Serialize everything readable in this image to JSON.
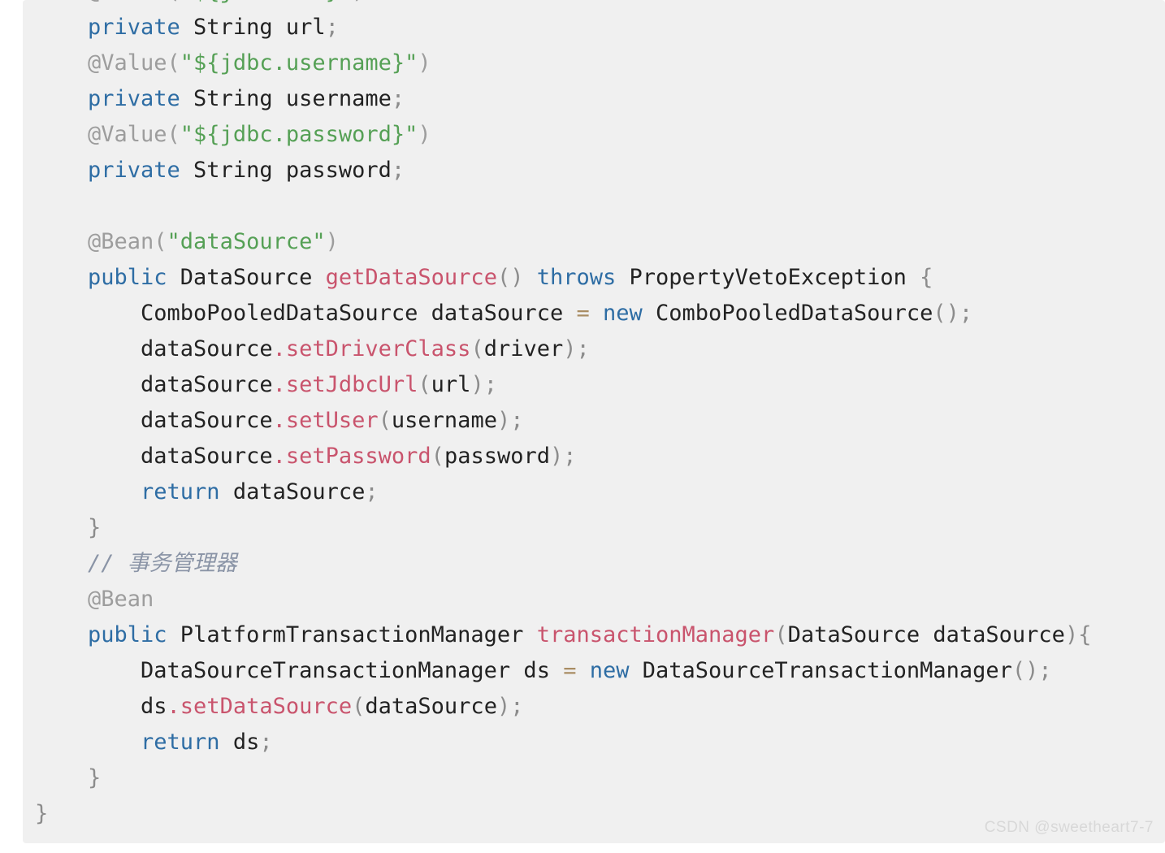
{
  "code_block": {
    "language": "java",
    "background_color": "#f0f0f0",
    "watermark": "CSDN @sweetheart7-7",
    "colors": {
      "keyword": "#2e6da4",
      "identifier": "#222222",
      "annotation": "#9d9d9d",
      "string": "#55a055",
      "method": "#c9546d",
      "punctuation": "#8c8c8c",
      "operator": "#a98d63",
      "comment": "#8a94a6"
    },
    "lines": [
      {
        "indent": 0,
        "tokens": [
          {
            "t": "ann",
            "v": "@Value("
          },
          {
            "t": "str",
            "v": "\"${jdbc.url}\""
          },
          {
            "t": "ann",
            "v": ")"
          }
        ]
      },
      {
        "indent": 0,
        "tokens": [
          {
            "t": "kw",
            "v": "private"
          },
          {
            "t": "plain",
            "v": " String url"
          },
          {
            "t": "punc",
            "v": ";"
          }
        ]
      },
      {
        "indent": 0,
        "tokens": [
          {
            "t": "ann",
            "v": "@Value("
          },
          {
            "t": "str",
            "v": "\"${jdbc.username}\""
          },
          {
            "t": "ann",
            "v": ")"
          }
        ]
      },
      {
        "indent": 0,
        "tokens": [
          {
            "t": "kw",
            "v": "private"
          },
          {
            "t": "plain",
            "v": " String username"
          },
          {
            "t": "punc",
            "v": ";"
          }
        ]
      },
      {
        "indent": 0,
        "tokens": [
          {
            "t": "ann",
            "v": "@Value("
          },
          {
            "t": "str",
            "v": "\"${jdbc.password}\""
          },
          {
            "t": "ann",
            "v": ")"
          }
        ]
      },
      {
        "indent": 0,
        "tokens": [
          {
            "t": "kw",
            "v": "private"
          },
          {
            "t": "plain",
            "v": " String password"
          },
          {
            "t": "punc",
            "v": ";"
          }
        ]
      },
      {
        "indent": 0,
        "tokens": []
      },
      {
        "indent": 0,
        "tokens": [
          {
            "t": "ann",
            "v": "@Bean("
          },
          {
            "t": "str",
            "v": "\"dataSource\""
          },
          {
            "t": "ann",
            "v": ")"
          }
        ]
      },
      {
        "indent": 0,
        "tokens": [
          {
            "t": "kw",
            "v": "public"
          },
          {
            "t": "plain",
            "v": " DataSource "
          },
          {
            "t": "meth",
            "v": "getDataSource"
          },
          {
            "t": "punc",
            "v": "()"
          },
          {
            "t": "plain",
            "v": " "
          },
          {
            "t": "kw",
            "v": "throws"
          },
          {
            "t": "plain",
            "v": " PropertyVetoException "
          },
          {
            "t": "punc",
            "v": "{"
          }
        ]
      },
      {
        "indent": 1,
        "tokens": [
          {
            "t": "plain",
            "v": "ComboPooledDataSource dataSource "
          },
          {
            "t": "op",
            "v": "="
          },
          {
            "t": "plain",
            "v": " "
          },
          {
            "t": "kw",
            "v": "new"
          },
          {
            "t": "plain",
            "v": " ComboPooledDataSource"
          },
          {
            "t": "punc",
            "v": "();"
          }
        ]
      },
      {
        "indent": 1,
        "tokens": [
          {
            "t": "plain",
            "v": "dataSource"
          },
          {
            "t": "meth",
            "v": ".setDriverClass"
          },
          {
            "t": "punc",
            "v": "("
          },
          {
            "t": "plain",
            "v": "driver"
          },
          {
            "t": "punc",
            "v": ");"
          }
        ]
      },
      {
        "indent": 1,
        "tokens": [
          {
            "t": "plain",
            "v": "dataSource"
          },
          {
            "t": "meth",
            "v": ".setJdbcUrl"
          },
          {
            "t": "punc",
            "v": "("
          },
          {
            "t": "plain",
            "v": "url"
          },
          {
            "t": "punc",
            "v": ");"
          }
        ]
      },
      {
        "indent": 1,
        "tokens": [
          {
            "t": "plain",
            "v": "dataSource"
          },
          {
            "t": "meth",
            "v": ".setUser"
          },
          {
            "t": "punc",
            "v": "("
          },
          {
            "t": "plain",
            "v": "username"
          },
          {
            "t": "punc",
            "v": ");"
          }
        ]
      },
      {
        "indent": 1,
        "tokens": [
          {
            "t": "plain",
            "v": "dataSource"
          },
          {
            "t": "meth",
            "v": ".setPassword"
          },
          {
            "t": "punc",
            "v": "("
          },
          {
            "t": "plain",
            "v": "password"
          },
          {
            "t": "punc",
            "v": ");"
          }
        ]
      },
      {
        "indent": 1,
        "tokens": [
          {
            "t": "kw",
            "v": "return"
          },
          {
            "t": "plain",
            "v": " dataSource"
          },
          {
            "t": "punc",
            "v": ";"
          }
        ]
      },
      {
        "indent": 0,
        "tokens": [
          {
            "t": "punc",
            "v": "}"
          }
        ]
      },
      {
        "indent": 0,
        "tokens": [
          {
            "t": "cmt",
            "v": "// 事务管理器"
          }
        ]
      },
      {
        "indent": 0,
        "tokens": [
          {
            "t": "ann",
            "v": "@Bean"
          }
        ]
      },
      {
        "indent": 0,
        "tokens": [
          {
            "t": "kw",
            "v": "public"
          },
          {
            "t": "plain",
            "v": " PlatformTransactionManager "
          },
          {
            "t": "meth",
            "v": "transactionManager"
          },
          {
            "t": "punc",
            "v": "("
          },
          {
            "t": "plain",
            "v": "DataSource dataSource"
          },
          {
            "t": "punc",
            "v": "){"
          }
        ]
      },
      {
        "indent": 1,
        "tokens": [
          {
            "t": "plain",
            "v": "DataSourceTransactionManager ds "
          },
          {
            "t": "op",
            "v": "="
          },
          {
            "t": "plain",
            "v": " "
          },
          {
            "t": "kw",
            "v": "new"
          },
          {
            "t": "plain",
            "v": " DataSourceTransactionManager"
          },
          {
            "t": "punc",
            "v": "();"
          }
        ]
      },
      {
        "indent": 1,
        "tokens": [
          {
            "t": "plain",
            "v": "ds"
          },
          {
            "t": "meth",
            "v": ".setDataSource"
          },
          {
            "t": "punc",
            "v": "("
          },
          {
            "t": "plain",
            "v": "dataSource"
          },
          {
            "t": "punc",
            "v": ");"
          }
        ]
      },
      {
        "indent": 1,
        "tokens": [
          {
            "t": "kw",
            "v": "return"
          },
          {
            "t": "plain",
            "v": " ds"
          },
          {
            "t": "punc",
            "v": ";"
          }
        ]
      },
      {
        "indent": 0,
        "tokens": [
          {
            "t": "punc",
            "v": "}"
          }
        ]
      },
      {
        "indent": -1,
        "tokens": [
          {
            "t": "punc",
            "v": "}"
          }
        ]
      }
    ]
  }
}
